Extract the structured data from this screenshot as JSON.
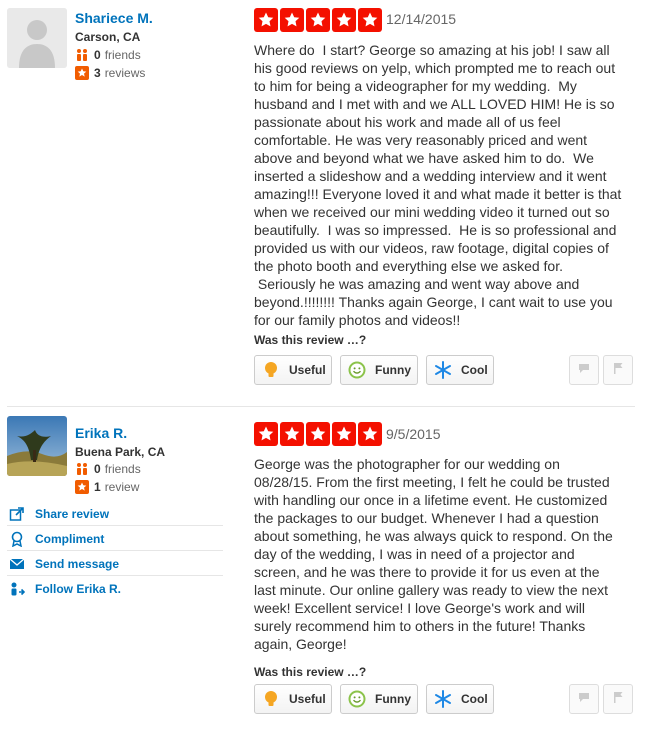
{
  "reviews": [
    {
      "user": {
        "name": "Shariece M.",
        "location": "Carson, CA",
        "friends_count": "0",
        "friends_label": "friends",
        "reviews_count": "3",
        "reviews_label": "reviews",
        "avatar": "default-avatar"
      },
      "rating": 5,
      "date": "12/14/2015",
      "text": "Where do  I start? George so amazing at his job! I saw all\nhis good reviews on yelp, which prompted me to reach out\nto him for being a videographer for my wedding.  My\nhusband and I met with and we ALL LOVED HIM! He is so\npassionate about his work and made all of us feel\ncomfortable. He was very reasonably priced and went\nabove and beyond what we have asked him to do.  We\ninserted a slideshow and a wedding interview and it went\namazing!!! Everyone loved it and what made it better is that\nwhen we received our mini wedding video it turned out so\nbeautifully.  I was so impressed.  He is so professional and\nprovided us with our videos, raw footage, digital copies of\nthe photo booth and everything else we asked for.\n Seriously he was amazing and went way above and\nbeyond.!!!!!!!! Thanks again George, I cant wait to use you\nfor our family photos and videos!!",
      "helpful_prompt": "Was this review …?",
      "votes": {
        "useful": "Useful",
        "funny": "Funny",
        "cool": "Cool"
      }
    },
    {
      "user": {
        "name": "Erika R.",
        "location": "Buena Park, CA",
        "friends_count": "0",
        "friends_label": "friends",
        "reviews_count": "1",
        "reviews_label": "review",
        "avatar": "landscape-photo"
      },
      "rating": 5,
      "date": "9/5/2015",
      "text": "George was the photographer for our wedding on\n08/28/15. From the first meeting, I felt he could be trusted\nwith handling our once in a lifetime event. He customized\nthe packages to our budget. Whenever I had a question\nabout something, he was always quick to respond. On the\nday of the wedding, I was in need of a projector and\nscreen, and he was there to provide it for us even at the\nlast minute. Our online gallery was ready to view the next\nweek! Excellent service! I love George's work and will\nsurely recommend him to others in the future! Thanks\nagain, George!",
      "helpful_prompt": "Was this review …?",
      "votes": {
        "useful": "Useful",
        "funny": "Funny",
        "cool": "Cool"
      },
      "actions": [
        {
          "label": "Share review",
          "icon": "share-icon"
        },
        {
          "label": "Compliment",
          "icon": "award-icon"
        },
        {
          "label": "Send message",
          "icon": "envelope-icon"
        },
        {
          "label": "Follow Erika R.",
          "icon": "follow-icon"
        }
      ]
    }
  ],
  "colors": {
    "star": "#f41000",
    "link": "#0073bb",
    "friends_icon": "#f15c00"
  }
}
